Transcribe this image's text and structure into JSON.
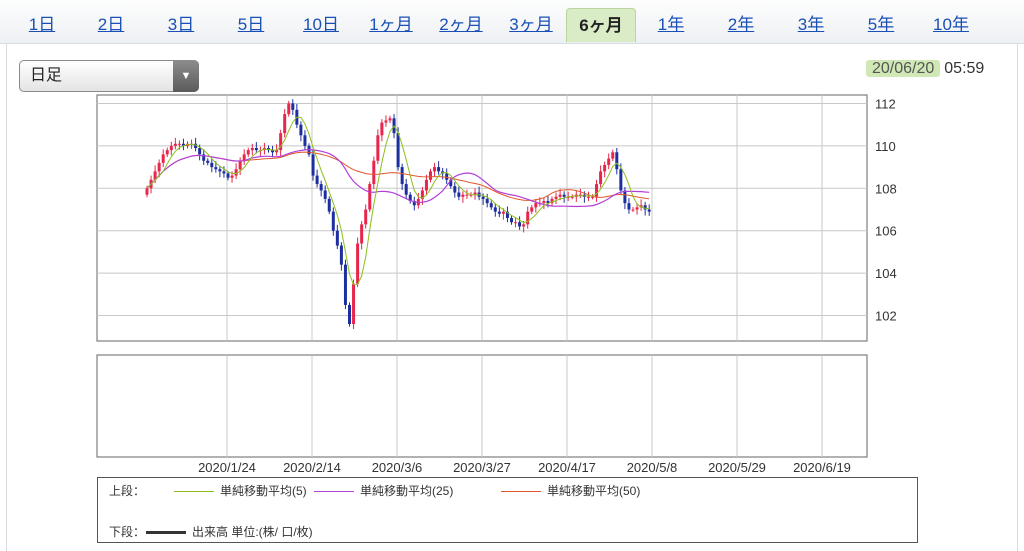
{
  "tabs": [
    {
      "label": "1日",
      "active": false
    },
    {
      "label": "2日",
      "active": false
    },
    {
      "label": "3日",
      "active": false
    },
    {
      "label": "5日",
      "active": false
    },
    {
      "label": "10日",
      "active": false
    },
    {
      "label": "1ヶ月",
      "active": false
    },
    {
      "label": "2ヶ月",
      "active": false
    },
    {
      "label": "3ヶ月",
      "active": false
    },
    {
      "label": "6ヶ月",
      "active": true
    },
    {
      "label": "1年",
      "active": false
    },
    {
      "label": "2年",
      "active": false
    },
    {
      "label": "3年",
      "active": false
    },
    {
      "label": "5年",
      "active": false
    },
    {
      "label": "10年",
      "active": false
    }
  ],
  "period_select": {
    "value": "日足"
  },
  "timestamp": {
    "date": "20/06/20",
    "time": "05:59"
  },
  "legend": {
    "upper_label": "上段：",
    "lower_label": "下段：",
    "ma5": "単純移動平均(5)",
    "ma25": "単純移動平均(25)",
    "ma50": "単純移動平均(50)",
    "volume": "出来高 単位:(株/ 口/枚)"
  },
  "colors": {
    "up": "#e8264b",
    "down": "#1d2fa0",
    "ma5": "#8bbf1e",
    "ma25": "#b33fd9",
    "ma50": "#e2572a",
    "grid": "#c8c8c8",
    "tab_active_bg": "#d9ecc6"
  },
  "chart_data": {
    "type": "candlestick",
    "x_tick_labels": [
      "2020/1/24",
      "2020/2/14",
      "2020/3/6",
      "2020/3/27",
      "2020/4/17",
      "2020/5/8",
      "2020/5/29",
      "2020/6/19"
    ],
    "y_ticks": [
      102,
      104,
      106,
      108,
      110,
      112
    ],
    "ylim": [
      100.8,
      112.4
    ],
    "series_names": [
      "単純移動平均(5)",
      "単純移動平均(25)",
      "単純移動平均(50)"
    ],
    "closes": [
      108.0,
      108.4,
      108.8,
      109.2,
      109.6,
      109.8,
      110.0,
      110.1,
      110.1,
      110.0,
      110.1,
      110.1,
      109.9,
      109.6,
      109.3,
      109.2,
      109.0,
      108.9,
      108.8,
      108.7,
      108.5,
      108.6,
      108.9,
      109.3,
      109.6,
      109.8,
      109.9,
      109.8,
      109.8,
      109.9,
      109.8,
      109.7,
      109.8,
      110.6,
      111.5,
      112.0,
      111.7,
      111.0,
      110.5,
      110.0,
      109.6,
      108.6,
      108.2,
      107.9,
      107.5,
      106.9,
      106.0,
      105.3,
      104.4,
      102.5,
      101.6,
      103.5,
      105.4,
      106.3,
      107.0,
      108.2,
      109.3,
      110.5,
      111.1,
      111.2,
      111.3,
      110.6,
      109.0,
      108.2,
      107.7,
      107.4,
      107.2,
      107.5,
      107.9,
      108.4,
      108.8,
      109.0,
      108.8,
      108.7,
      108.4,
      108.1,
      107.8,
      107.6,
      107.7,
      107.7,
      107.7,
      107.8,
      107.6,
      107.5,
      107.3,
      107.1,
      106.9,
      106.8,
      106.9,
      106.6,
      106.4,
      106.4,
      106.2,
      106.3,
      106.9,
      107.1,
      107.3,
      107.3,
      107.4,
      107.3,
      107.5,
      107.6,
      107.7,
      107.6,
      107.6,
      107.6,
      107.7,
      107.7,
      107.6,
      107.6,
      107.6,
      108.2,
      108.8,
      109.1,
      109.4,
      109.7,
      108.9,
      107.9,
      107.3,
      107.0,
      107.0,
      107.1,
      107.2,
      107.0,
      106.9
    ]
  }
}
